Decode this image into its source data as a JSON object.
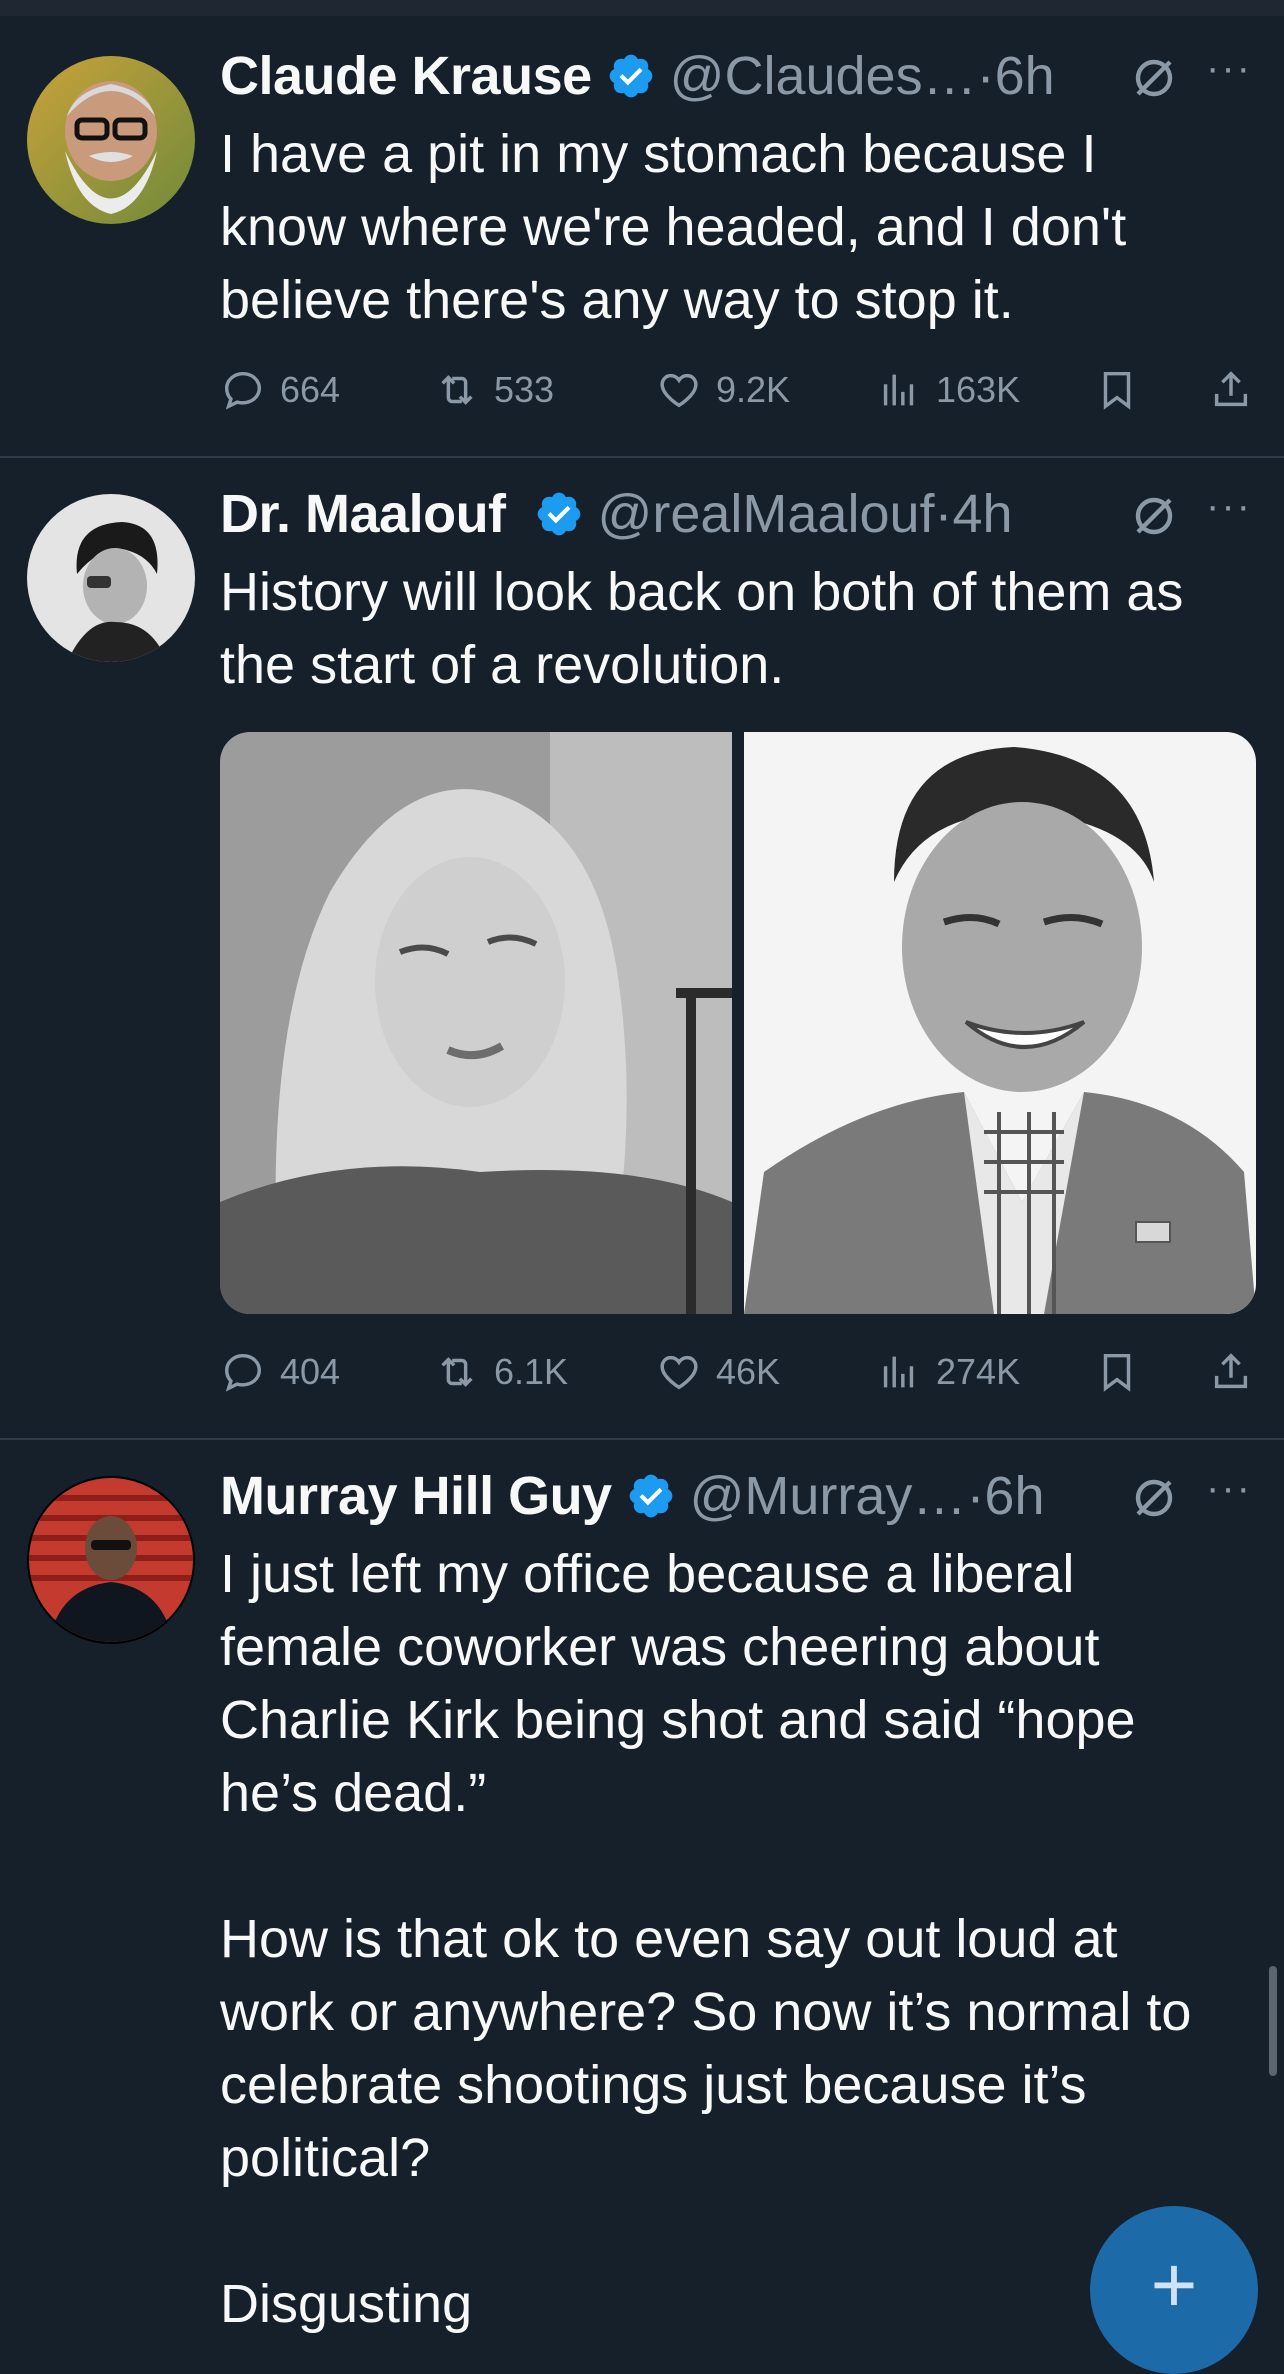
{
  "tweets": [
    {
      "name": "Claude Krause",
      "handle": "@Claudes…",
      "time": "·6h",
      "text": "I have a pit in my stomach because I\nknow where we're headed, and I don't\nbelieve there's any way to stop it.",
      "replies": "664",
      "reposts": "533",
      "likes": "9.2K",
      "views": "163K"
    },
    {
      "name": "Dr. Maalouf",
      "handle": "@realMaalouf",
      "time": "·4h",
      "text": "History will look back on both of them as\nthe start of a revolution.",
      "replies": "404",
      "reposts": "6.1K",
      "likes": "46K",
      "views": "274K"
    },
    {
      "name": "Murray Hill Guy",
      "handle": "@Murray…",
      "time": "·6h",
      "text": "I just left my office because a liberal\nfemale coworker was cheering about\nCharlie Kirk being shot and said “hope\nhe’s dead.”\n\nHow is that ok to even say out loud at\nwork or anywhere? So now it’s normal to\ncelebrate shootings just because it’s\npolitical?\n\nDisgusting"
    }
  ],
  "fab_label": "+",
  "colors": {
    "background": "#15202b",
    "verified": "#1d9bf0",
    "muted": "#8b98a5",
    "fab": "#1d6aa8"
  },
  "icons": [
    "verified-badge-icon",
    "grok-icon",
    "more-icon",
    "reply-icon",
    "repost-icon",
    "like-icon",
    "views-icon",
    "bookmark-icon",
    "share-icon",
    "plus-icon"
  ]
}
